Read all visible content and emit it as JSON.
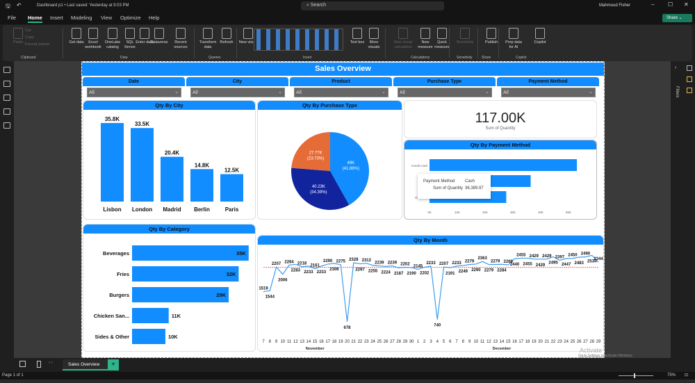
{
  "titlebar": {
    "doc_title": "Dashboard p1 • Last saved: Yesterday at 9:03 PM",
    "search_placeholder": "Search",
    "user": "Mahmoud Fisher",
    "share": "Share"
  },
  "menu": [
    "File",
    "Home",
    "Insert",
    "Modeling",
    "View",
    "Optimize",
    "Help"
  ],
  "ribbon": {
    "buttons": [
      {
        "label": "Paste",
        "disabled": true
      },
      {
        "label": "Get data",
        "disabled": false
      },
      {
        "label": "Excel workbook",
        "disabled": false
      },
      {
        "label": "OneLake catalog",
        "disabled": false
      },
      {
        "label": "SQL Server",
        "disabled": false
      },
      {
        "label": "Enter data",
        "disabled": false
      },
      {
        "label": "Dataverse",
        "disabled": false
      },
      {
        "label": "Recent sources",
        "disabled": false
      },
      {
        "label": "Transform data",
        "disabled": false
      },
      {
        "label": "Refresh",
        "disabled": false
      },
      {
        "label": "New visual",
        "disabled": false
      },
      {
        "label": "Text box",
        "disabled": false
      },
      {
        "label": "More visuals",
        "disabled": false
      },
      {
        "label": "New visual calculation",
        "disabled": true
      },
      {
        "label": "New measure",
        "disabled": false
      },
      {
        "label": "Quick measure",
        "disabled": false
      },
      {
        "label": "Sensitivity",
        "disabled": true
      },
      {
        "label": "Publish",
        "disabled": false
      },
      {
        "label": "Prep data for AI",
        "disabled": false
      },
      {
        "label": "Copilot",
        "disabled": false
      }
    ],
    "small": [
      "Cut",
      "Copy",
      "Format painter"
    ],
    "groups": [
      "Clipboard",
      "Data",
      "Queries",
      "Insert",
      "Calculations",
      "Sensitivity",
      "Share",
      "Copilot"
    ]
  },
  "report": {
    "title": "Sales Overview",
    "filters": [
      {
        "label": "Date",
        "value": "All"
      },
      {
        "label": "City",
        "value": "All"
      },
      {
        "label": "Product",
        "value": "All"
      },
      {
        "label": "Purchase Type",
        "value": "All"
      },
      {
        "label": "Payment Method",
        "value": "All"
      }
    ],
    "kpi": {
      "value": "117.00K",
      "label": "Sum of Quantity"
    },
    "tooltip": {
      "k1": "Payment Method",
      "v1": "Cash",
      "k2": "Sum of Quantity",
      "v2": "36,389.97"
    }
  },
  "chart_data": [
    {
      "type": "bar",
      "title": "Qty By City",
      "categories": [
        "Lisbon",
        "London",
        "Madrid",
        "Berlin",
        "Paris"
      ],
      "values": [
        35.8,
        33.5,
        20.4,
        14.8,
        12.5
      ],
      "labels": [
        "35.8K",
        "33.5K",
        "20.4K",
        "14.8K",
        "12.5K"
      ],
      "unit": "K"
    },
    {
      "type": "pie",
      "title": "Qty By Purchase Type",
      "slices": [
        {
          "value": 49,
          "label": "49K",
          "pct": "(41.88%)",
          "color": "#118dff"
        },
        {
          "value": 40.23,
          "label": "40.23K",
          "pct": "(34.39%)",
          "color": "#12239e"
        },
        {
          "value": 27.77,
          "label": "27.77K",
          "pct": "(23.73%)",
          "color": "#e66c37"
        }
      ]
    },
    {
      "type": "bar",
      "orientation": "horizontal",
      "title": "Qty By Payment Method",
      "categories": [
        "Credit Card",
        "Cash",
        "Gift Card"
      ],
      "values": [
        53,
        36.39,
        27.6
      ],
      "xticks": [
        "0K",
        "10K",
        "20K",
        "30K",
        "40K",
        "50K"
      ],
      "xlim": [
        0,
        55
      ]
    },
    {
      "type": "bar",
      "orientation": "horizontal",
      "title": "Qty By Category",
      "categories": [
        "Beverages",
        "Fries",
        "Burgers",
        "Chicken San...",
        "Sides & Other"
      ],
      "values": [
        35,
        32,
        29,
        11,
        10
      ],
      "labels": [
        "35K",
        "32K",
        "29K",
        "11K",
        "10K"
      ]
    },
    {
      "type": "line",
      "title": "Qty By Month",
      "x": [
        "7",
        "8",
        "9",
        "10",
        "11",
        "12",
        "13",
        "14",
        "15",
        "16",
        "17",
        "18",
        "19",
        "20",
        "21",
        "22",
        "23",
        "24",
        "25",
        "26",
        "27",
        "28",
        "29",
        "30",
        "1",
        "2",
        "3",
        "4",
        "5",
        "6",
        "7",
        "8",
        "9",
        "10",
        "11",
        "12",
        "13",
        "14",
        "15",
        "16",
        "17",
        "18",
        "19",
        "20",
        "21",
        "22",
        "23",
        "24",
        "25",
        "26",
        "27",
        "28",
        "29"
      ],
      "values": [
        1519,
        1544,
        2207,
        2006,
        2264,
        2283,
        2218,
        2233,
        2161,
        2233,
        2290,
        2306,
        2275,
        678,
        2328,
        2297,
        2312,
        2255,
        2239,
        2224,
        2239,
        2187,
        2202,
        2190,
        2145,
        2202,
        2233,
        740,
        2207,
        2191,
        2233,
        2249,
        2279,
        2290,
        2363,
        2279,
        2279,
        2284,
        2269,
        2440,
        2455,
        2455,
        2429,
        2429,
        2429,
        2495,
        2397,
        2447,
        2450,
        2483,
        2490,
        2534,
        2344
      ],
      "month_labels": [
        "November",
        "December"
      ],
      "average_line": 2200,
      "ylim": [
        500,
        2600
      ]
    }
  ],
  "bottom": {
    "page_tab": "Sales Overview",
    "page_count": "Page 1 of 1",
    "zoom": "75%",
    "filters_pane": "Filters",
    "watermark1": "Activate Windows",
    "watermark2": "Go to Settings to activate Windows."
  }
}
